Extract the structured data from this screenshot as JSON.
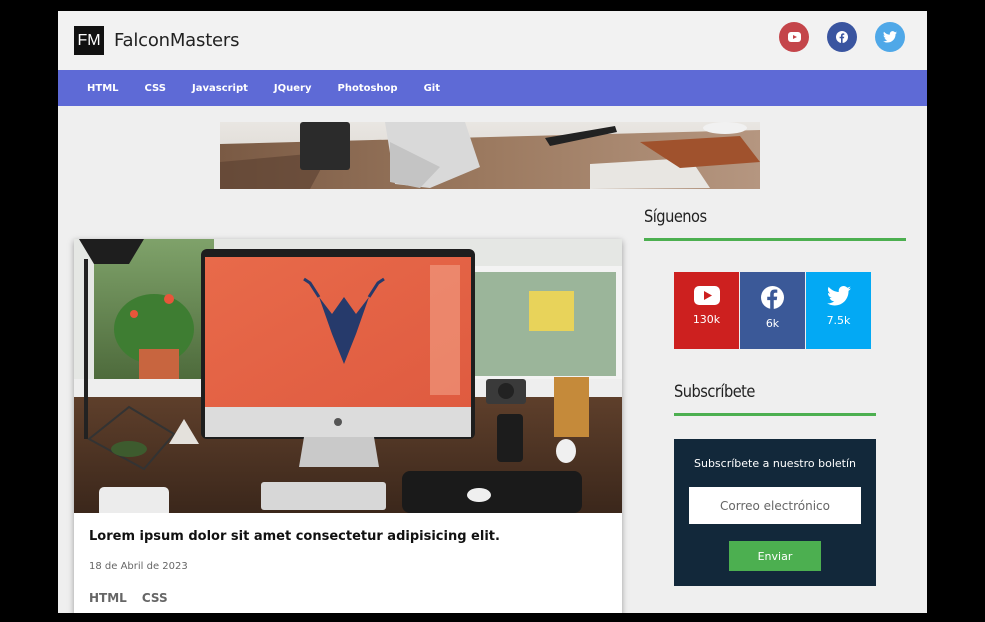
{
  "header": {
    "logo_mark": "FM",
    "logo_text": "FalconMasters",
    "social": [
      {
        "name": "youtube",
        "color": "#c4454a"
      },
      {
        "name": "facebook",
        "color": "#3a55a0"
      },
      {
        "name": "twitter",
        "color": "#4fa8e8"
      }
    ]
  },
  "nav": {
    "items": [
      "HTML",
      "CSS",
      "Javascript",
      "JQuery",
      "Photoshop",
      "Git"
    ],
    "color": "#5e6ad6"
  },
  "post": {
    "title": "Lorem ipsum dolor sit amet consectetur adipisicing elit.",
    "date": "18 de Abril de 2023",
    "tags": [
      "HTML",
      "CSS"
    ]
  },
  "sidebar": {
    "follow_title": "Síguenos",
    "follow": [
      {
        "network": "youtube",
        "count": "130k",
        "color": "#cd201f"
      },
      {
        "network": "facebook",
        "count": "6k",
        "color": "#3b5998"
      },
      {
        "network": "twitter",
        "count": "7.5k",
        "color": "#03a9f4"
      }
    ],
    "subscribe_title": "Subscríbete",
    "subscribe": {
      "heading": "Subscríbete a nuestro boletín",
      "placeholder": "Correo electrónico",
      "button": "Enviar"
    },
    "accent": "#4caf50"
  }
}
